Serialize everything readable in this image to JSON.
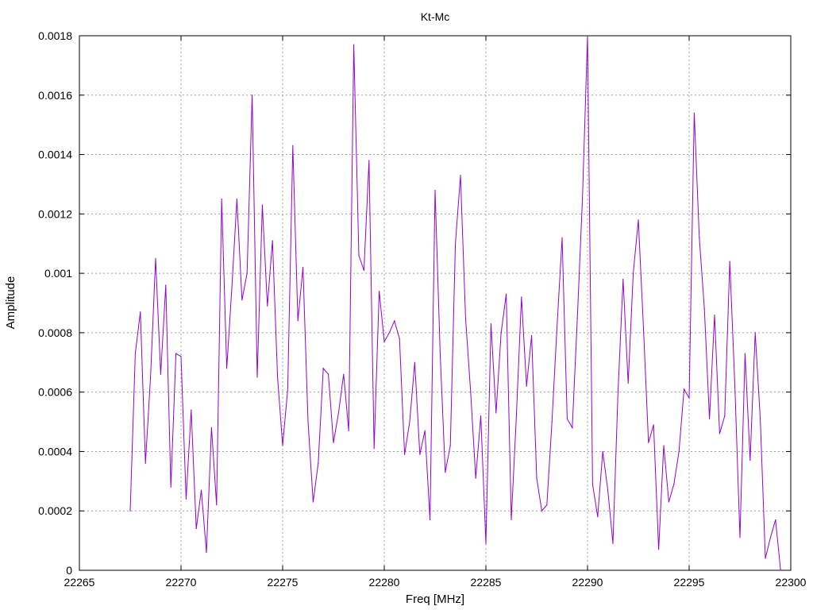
{
  "chart_data": {
    "type": "line",
    "title": "Kt-Mc",
    "xlabel": "Freq [MHz]",
    "ylabel": "Amplitude",
    "xlim": [
      22265,
      22300
    ],
    "ylim": [
      0,
      0.0018
    ],
    "grid": true,
    "x_ticks": [
      22265,
      22270,
      22275,
      22280,
      22285,
      22290,
      22295,
      22300
    ],
    "x_tick_labels": [
      "22265",
      "22270",
      "22275",
      "22280",
      "22285",
      "22290",
      "22295",
      "22300"
    ],
    "y_ticks": [
      0,
      0.0002,
      0.0004,
      0.0006,
      0.0008,
      0.001,
      0.0012,
      0.0014,
      0.0016,
      0.0018
    ],
    "y_tick_labels": [
      "0",
      "0.0002",
      "0.0004",
      "0.0006",
      "0.0008",
      "0.001",
      "0.0012",
      "0.0014",
      "0.0016",
      "0.0018"
    ],
    "series": [
      {
        "color": "#9400d3",
        "x": [
          22267.5,
          22267.75,
          22268.0,
          22268.25,
          22268.5,
          22268.75,
          22269.0,
          22269.25,
          22269.5,
          22269.75,
          22270.0,
          22270.25,
          22270.5,
          22270.75,
          22271.0,
          22271.25,
          22271.5,
          22271.75,
          22272.0,
          22272.25,
          22272.5,
          22272.75,
          22273.0,
          22273.25,
          22273.5,
          22273.75,
          22274.0,
          22274.25,
          22274.5,
          22274.75,
          22275.0,
          22275.25,
          22275.5,
          22275.75,
          22276.0,
          22276.25,
          22276.5,
          22276.75,
          22277.0,
          22277.25,
          22277.5,
          22277.75,
          22278.0,
          22278.25,
          22278.5,
          22278.75,
          22279.0,
          22279.25,
          22279.5,
          22279.75,
          22280.0,
          22280.25,
          22280.5,
          22280.75,
          22281.0,
          22281.25,
          22281.5,
          22281.75,
          22282.0,
          22282.25,
          22282.5,
          22282.75,
          22283.0,
          22283.25,
          22283.5,
          22283.75,
          22284.0,
          22284.25,
          22284.5,
          22284.75,
          22285.0,
          22285.25,
          22285.5,
          22285.75,
          22286.0,
          22286.25,
          22286.5,
          22286.75,
          22287.0,
          22287.25,
          22287.5,
          22287.75,
          22288.0,
          22288.25,
          22288.5,
          22288.75,
          22289.0,
          22289.25,
          22289.5,
          22289.75,
          22290.0,
          22290.25,
          22290.5,
          22290.75,
          22291.0,
          22291.25,
          22291.5,
          22291.75,
          22292.0,
          22292.25,
          22292.5,
          22292.75,
          22293.0,
          22293.25,
          22293.5,
          22293.75,
          22294.0,
          22294.25,
          22294.5,
          22294.75,
          22295.0,
          22295.25,
          22295.5,
          22295.75,
          22296.0,
          22296.25,
          22296.5,
          22296.75,
          22297.0,
          22297.25,
          22297.5,
          22297.75,
          22298.0,
          22298.25,
          22298.5,
          22298.75,
          22299.0,
          22299.25,
          22299.5
        ],
        "values": [
          0.0002,
          0.00073,
          0.00087,
          0.00036,
          0.00065,
          0.00105,
          0.00066,
          0.00096,
          0.00028,
          0.00073,
          0.00072,
          0.00024,
          0.00054,
          0.00014,
          0.00027,
          6e-05,
          0.00048,
          0.00022,
          0.00125,
          0.00068,
          0.00095,
          0.00125,
          0.00091,
          0.001,
          0.0016,
          0.00065,
          0.00123,
          0.00089,
          0.00111,
          0.00065,
          0.00042,
          0.00061,
          0.00143,
          0.00084,
          0.00102,
          0.0005,
          0.00023,
          0.00036,
          0.00068,
          0.00066,
          0.00043,
          0.00053,
          0.00066,
          0.00047,
          0.00177,
          0.00106,
          0.00101,
          0.00138,
          0.00041,
          0.00094,
          0.00077,
          0.0008,
          0.00084,
          0.00078,
          0.00039,
          0.0005,
          0.0007,
          0.00039,
          0.00047,
          0.00017,
          0.00128,
          0.00073,
          0.00033,
          0.00042,
          0.0011,
          0.00133,
          0.00085,
          0.0006,
          0.00031,
          0.00052,
          9e-05,
          0.00083,
          0.00053,
          0.0008,
          0.00093,
          0.00017,
          0.00052,
          0.00092,
          0.00062,
          0.00079,
          0.00031,
          0.0002,
          0.00022,
          0.0005,
          0.00082,
          0.00112,
          0.00051,
          0.00048,
          0.00085,
          0.00125,
          0.0018,
          0.00029,
          0.00018,
          0.0004,
          0.00027,
          9e-05,
          0.0006,
          0.00098,
          0.00063,
          0.001,
          0.00118,
          0.00082,
          0.00043,
          0.00049,
          7e-05,
          0.00042,
          0.00023,
          0.00029,
          0.0004,
          0.00061,
          0.00058,
          0.00154,
          0.00112,
          0.00088,
          0.00051,
          0.00086,
          0.00046,
          0.00052,
          0.00104,
          0.00062,
          0.00011,
          0.00073,
          0.00037,
          0.0008,
          0.00051,
          4e-05,
          0.00011,
          0.00017,
          0.0
        ]
      }
    ]
  }
}
